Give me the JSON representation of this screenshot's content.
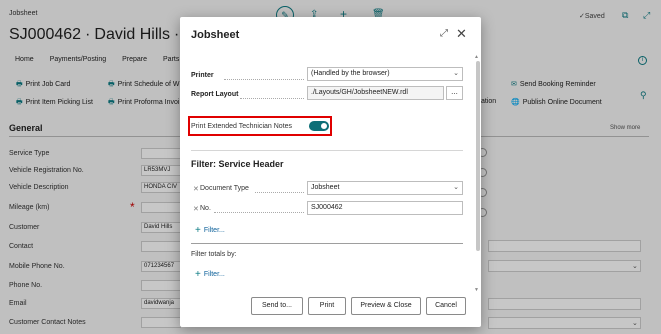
{
  "background": {
    "top_label": "Jobsheet",
    "title": "SJ000462 ∙ David Hills ∙ LR5",
    "status": "✓Saved",
    "menu": [
      "Home",
      "Payments/Posting",
      "Prepare",
      "Parts",
      "Lo"
    ],
    "actions": [
      {
        "label": "Print Job Card",
        "icon": "print-icon"
      },
      {
        "label": "Print Schedule of W",
        "icon": "print-icon"
      },
      {
        "label": "Print Item Picking List",
        "icon": "print-icon"
      },
      {
        "label": "Print Proforma Invoi",
        "icon": "print-icon"
      },
      {
        "label": "Send Booking Reminder",
        "icon": "send-icon"
      },
      {
        "label": "ation",
        "icon": ""
      },
      {
        "label": "Publish Online Document",
        "icon": "globe-icon"
      }
    ],
    "section": "General",
    "show_more": "Show more",
    "fields": [
      {
        "label": "Service Type",
        "value": ""
      },
      {
        "label": "Vehicle Registration No.",
        "value": "LR53MVJ"
      },
      {
        "label": "Vehicle Description",
        "value": "HONDA CIV"
      },
      {
        "label": "Mileage (km)",
        "value": ""
      },
      {
        "label": "Customer",
        "value": "David Hills"
      },
      {
        "label": "Contact",
        "value": ""
      },
      {
        "label": "Mobile Phone No.",
        "value": "071234567"
      },
      {
        "label": "Phone No.",
        "value": ""
      },
      {
        "label": "Email",
        "value": "davidwanja"
      },
      {
        "label": "Customer Contact Notes",
        "value": ""
      }
    ]
  },
  "dialog": {
    "title": "Jobsheet",
    "printer_label": "Printer",
    "printer_value": "(Handled by the browser)",
    "report_layout_label": "Report Layout",
    "report_layout_value": "./Layouts/GH/JobsheetNEW.rdl",
    "ellipsis": "...",
    "extended_notes_label": "Print Extended Technician Notes",
    "extended_notes_on": true,
    "filter_header_title": "Filter: Service Header",
    "document_type_label": "Document Type",
    "document_type_value": "Jobsheet",
    "no_label": "No.",
    "no_value": "SJ000462",
    "add_filter": "Filter...",
    "filter_totals_label": "Filter totals by:",
    "add_filter_totals": "Filter...",
    "buttons": {
      "send_to": "Send to...",
      "print": "Print",
      "preview_close": "Preview & Close",
      "cancel": "Cancel"
    },
    "colors": {
      "toggle_on": "#0c6f77",
      "highlight": "#e00000",
      "link": "#0b5f99"
    }
  }
}
